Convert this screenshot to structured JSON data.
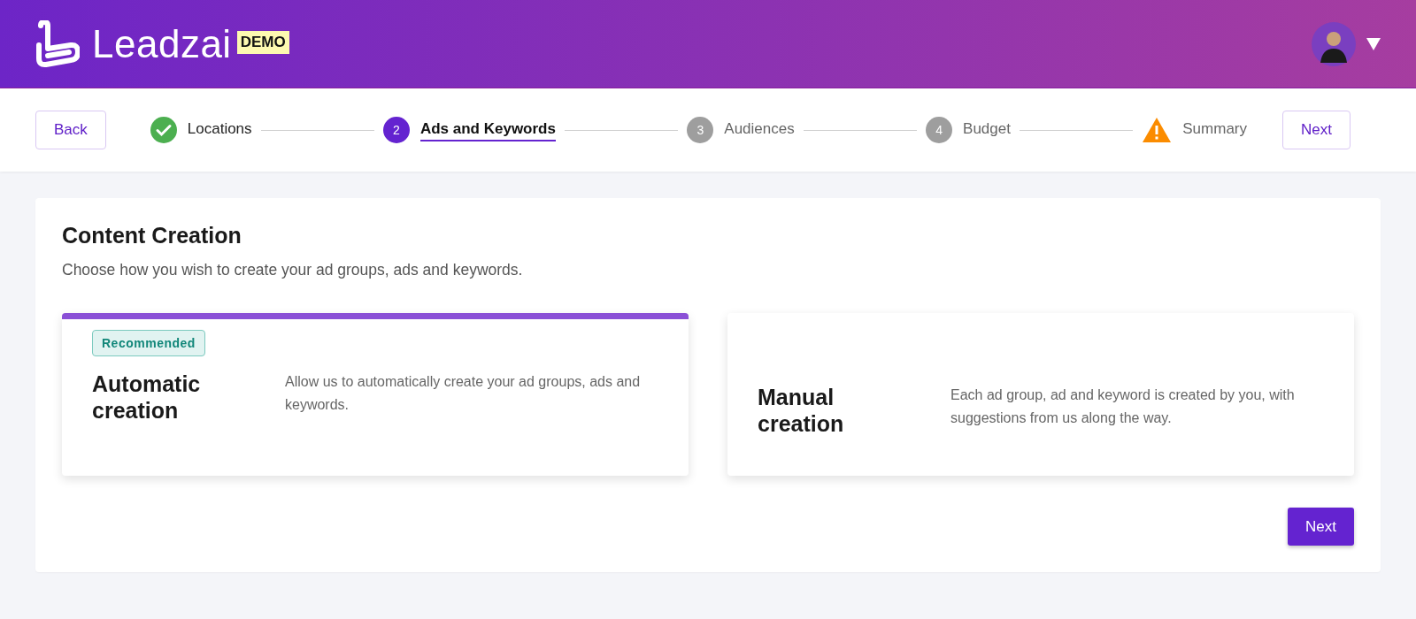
{
  "header": {
    "brand": "Leadzai",
    "badge": "DEMO"
  },
  "stepper": {
    "back": "Back",
    "next": "Next",
    "steps": [
      {
        "label": "Locations",
        "kind": "done",
        "selected": false
      },
      {
        "label": "Ads and Keywords",
        "kind": "current",
        "number": "2",
        "selected": true
      },
      {
        "label": "Audiences",
        "kind": "pending",
        "number": "3",
        "selected": false
      },
      {
        "label": "Budget",
        "kind": "pending",
        "number": "4",
        "selected": false
      },
      {
        "label": "Summary",
        "kind": "warning",
        "selected": false
      }
    ]
  },
  "content": {
    "title": "Content Creation",
    "subtitle": "Choose how you wish to create your ad groups, ads and keywords.",
    "options": [
      {
        "title": "Automatic creation",
        "description": "Allow us to automatically create your ad groups, ads and keywords.",
        "badge": "Recommended",
        "selected": true
      },
      {
        "title": "Manual creation",
        "description": "Each ad group, ad and keyword is created by you, with suggestions from us along the way.",
        "selected": false
      }
    ],
    "next": "Next"
  }
}
